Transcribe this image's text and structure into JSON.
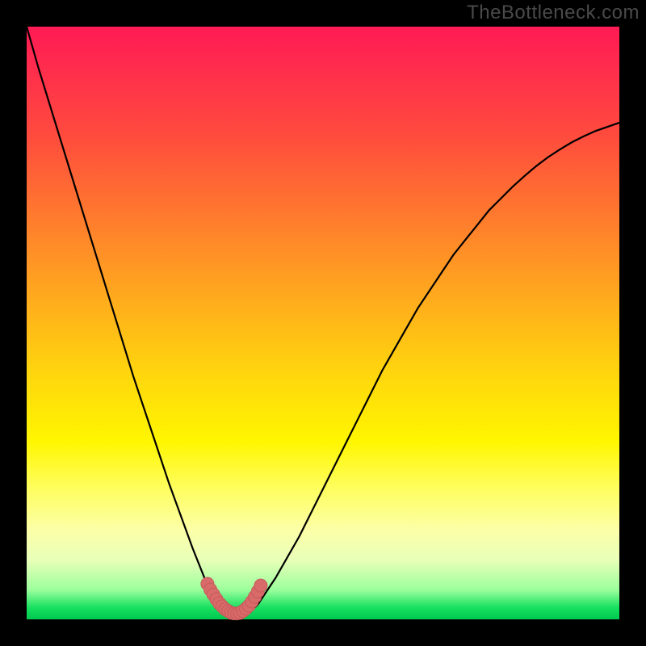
{
  "watermark": "TheBottleneck.com",
  "colors": {
    "frame": "#000000",
    "curve": "#000000",
    "marker_fill": "#d96a6a",
    "marker_stroke": "#c65a5a",
    "gradient_top": "#ff1a54",
    "gradient_bottom": "#00c850"
  },
  "chart_data": {
    "type": "line",
    "title": "",
    "xlabel": "",
    "ylabel": "",
    "xlim": [
      0,
      100
    ],
    "ylim": [
      0,
      100
    ],
    "grid": false,
    "legend": false,
    "annotations": [],
    "x": [
      0,
      2,
      4,
      6,
      8,
      10,
      12,
      14,
      16,
      18,
      20,
      22,
      24,
      26,
      28,
      30,
      31,
      32,
      33,
      34,
      35,
      36,
      37,
      38,
      39,
      40,
      42,
      44,
      46,
      48,
      50,
      52,
      54,
      56,
      58,
      60,
      62,
      64,
      66,
      68,
      70,
      72,
      74,
      76,
      78,
      80,
      82,
      84,
      86,
      88,
      90,
      92,
      94,
      96,
      98,
      100
    ],
    "values": [
      100,
      93,
      86.5,
      80,
      73.5,
      67,
      60.5,
      54,
      47.5,
      41,
      35,
      29,
      23,
      17.5,
      12,
      7,
      5,
      3.5,
      2.3,
      1.5,
      1,
      0.8,
      1,
      1.5,
      2.5,
      4,
      7,
      10.5,
      14,
      18,
      22,
      26,
      30,
      34,
      38,
      42,
      45.5,
      49,
      52.5,
      55.5,
      58.5,
      61.5,
      64,
      66.5,
      69,
      71,
      73,
      74.8,
      76.5,
      78,
      79.3,
      80.5,
      81.5,
      82.4,
      83.1,
      83.8
    ],
    "markers": {
      "x": [
        30.5,
        31.0,
        31.5,
        32.0,
        32.5,
        33.0,
        33.5,
        34.0,
        34.5,
        35.0,
        35.5,
        36.0,
        36.5,
        37.0,
        37.5,
        38.0,
        38.5,
        39.0,
        39.5
      ],
      "y": [
        6.0,
        5.0,
        4.2,
        3.4,
        2.7,
        2.2,
        1.7,
        1.4,
        1.1,
        1.0,
        1.0,
        1.1,
        1.4,
        1.8,
        2.3,
        3.0,
        3.8,
        4.7,
        5.7
      ]
    }
  }
}
